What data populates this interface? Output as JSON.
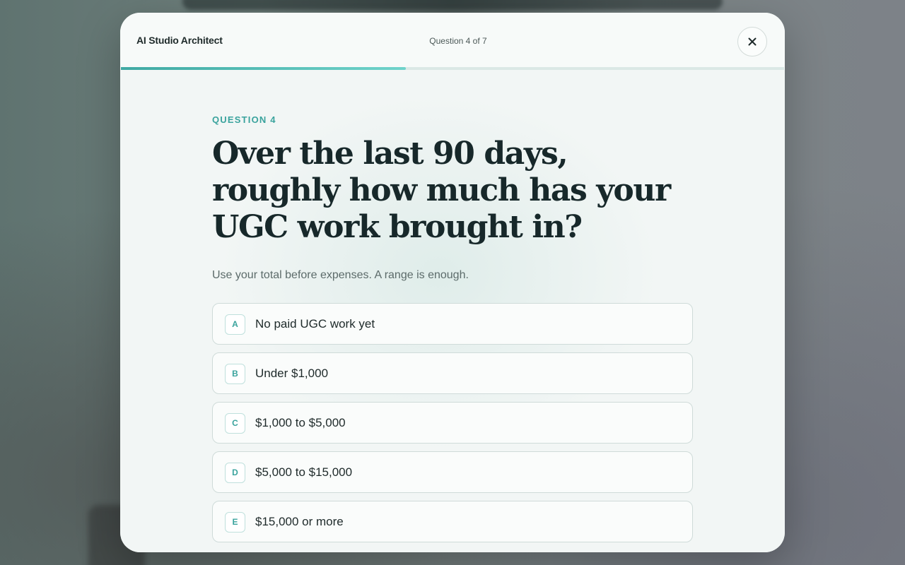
{
  "header": {
    "brand": "AI Studio Architect",
    "step_label": "Question 4 of 7",
    "close_icon": "close-icon",
    "progress": 0.43
  },
  "question": {
    "eyebrow": "QUESTION 4",
    "title": "Over the last 90 days, roughly how much has your UGC work brought in?",
    "hint": "Use your total before expenses. A range is enough."
  },
  "options": [
    {
      "key": "A",
      "label": "No paid UGC work yet"
    },
    {
      "key": "B",
      "label": "Under $1,000"
    },
    {
      "key": "C",
      "label": "$1,000 to $5,000"
    },
    {
      "key": "D",
      "label": "$5,000 to $15,000"
    },
    {
      "key": "E",
      "label": "$15,000 or more"
    }
  ],
  "colors": {
    "accent": "#3aa39d",
    "heading": "#17282a",
    "surface": "#f4f7f6"
  }
}
